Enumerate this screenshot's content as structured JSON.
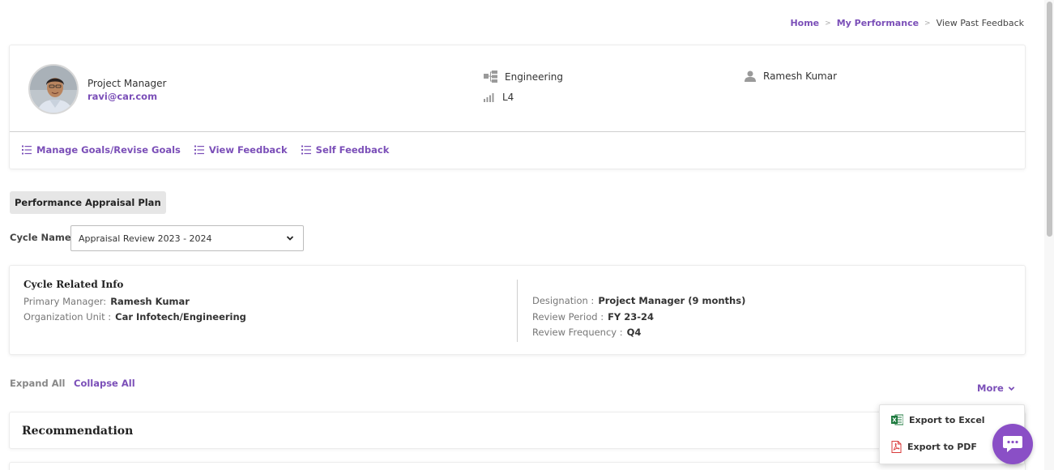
{
  "breadcrumb": {
    "home": "Home",
    "my_performance": "My Performance",
    "current": "View Past Feedback"
  },
  "profile": {
    "role": "Project Manager",
    "email": "ravi@car.com",
    "department": "Engineering",
    "level": "L4",
    "manager": "Ramesh Kumar"
  },
  "profile_links": {
    "manage_goals": "Manage Goals/Revise Goals",
    "view_feedback": "View Feedback",
    "self_feedback": "Self Feedback"
  },
  "plan_tag": "Performance Appraisal Plan",
  "cycle": {
    "label": "Cycle Name",
    "selected": "Appraisal Review 2023 - 2024"
  },
  "cycle_info": {
    "title": "Cycle Related Info",
    "primary_manager_label": "Primary Manager:",
    "primary_manager_value": "Ramesh Kumar",
    "org_unit_label": "Organization Unit :",
    "org_unit_value": "Car Infotech/Engineering",
    "designation_label": "Designation :",
    "designation_value": "Project Manager (9 months)",
    "review_period_label": "Review Period :",
    "review_period_value": "FY 23-24",
    "review_frequency_label": "Review Frequency :",
    "review_frequency_value": "Q4"
  },
  "controls": {
    "expand_all": "Expand All",
    "collapse_all": "Collapse All",
    "more": "More"
  },
  "recommendation_title": "Recommendation",
  "more_menu": {
    "export_excel": "Export to Excel",
    "export_pdf": "Export to PDF"
  },
  "colors": {
    "accent": "#7b4fb8",
    "chat_fab": "#8a4fc6",
    "excel_green": "#1d7a3e",
    "pdf_red": "#d93a3a"
  },
  "icons": {
    "department": "org-structure-icon",
    "level": "signal-bars-icon",
    "manager": "user-icon",
    "list": "list-icon",
    "chevron": "chevron-down-icon",
    "excel": "excel-file-icon",
    "pdf": "pdf-file-icon",
    "chat": "chat-bubble-icon"
  }
}
